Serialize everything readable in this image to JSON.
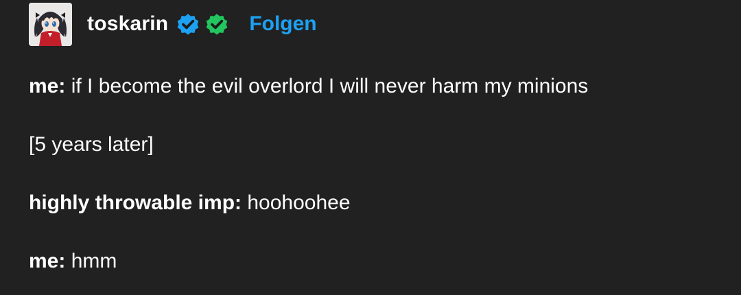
{
  "post": {
    "author": {
      "username": "toskarin",
      "follow_label": "Folgen",
      "badges": [
        "verified-blue-badge-icon",
        "verified-green-badge-icon"
      ]
    },
    "lines": [
      {
        "speaker": "me:",
        "text": " if I become the evil overlord I will never harm my minions"
      },
      {
        "speaker": "",
        "text": "[5 years later]"
      },
      {
        "speaker": "highly throwable imp:",
        "text": " hoohoohee"
      },
      {
        "speaker": "me:",
        "text": " hmm"
      }
    ]
  },
  "colors": {
    "background": "#212121",
    "text": "#ffffff",
    "follow": "#1da1f2",
    "badge_blue": "#1da1f2",
    "badge_green": "#22c55e"
  }
}
